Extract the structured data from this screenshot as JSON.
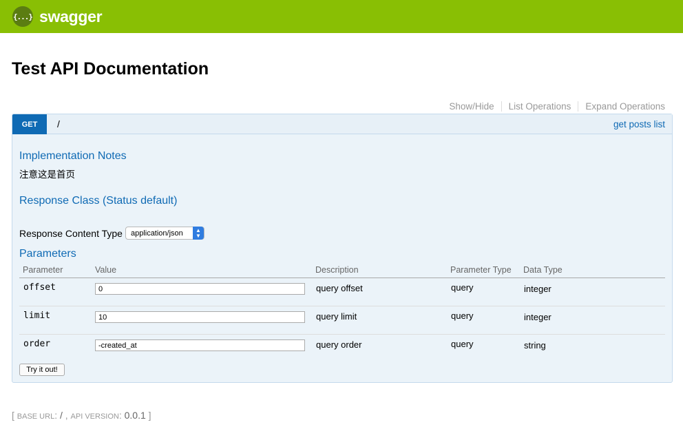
{
  "header": {
    "logo_mark": "{...}",
    "logo_text": "swagger"
  },
  "page": {
    "title": "Test API Documentation"
  },
  "operations": {
    "show_hide": "Show/Hide",
    "list_operations": "List Operations",
    "expand_operations": "Expand Operations"
  },
  "endpoint": {
    "method": "GET",
    "path": "/",
    "summary": "get posts list",
    "implementation_notes_title": "Implementation Notes",
    "implementation_notes": "注意这是首页",
    "response_class_title": "Response Class (Status default)",
    "response_content_type_label": "Response Content Type",
    "response_content_type_value": "application/json",
    "parameters_title": "Parameters",
    "param_headers": [
      "Parameter",
      "Value",
      "Description",
      "Parameter Type",
      "Data Type"
    ],
    "params": [
      {
        "name": "offset",
        "value": "0",
        "description": "query offset",
        "param_type": "query",
        "data_type": "integer"
      },
      {
        "name": "limit",
        "value": "10",
        "description": "query limit",
        "param_type": "query",
        "data_type": "integer"
      },
      {
        "name": "order",
        "value": "-created_at",
        "description": "query order",
        "param_type": "query",
        "data_type": "string"
      }
    ],
    "try_button": "Try it out!"
  },
  "footer": {
    "open": "[",
    "base_url_label": "base url",
    "base_url": "/",
    "api_version_label": "api version",
    "api_version": "0.0.1",
    "close": "]"
  },
  "colors": {
    "brand": "#89bf04",
    "get": "#0f6ab4",
    "panel": "#ebf3f9"
  }
}
